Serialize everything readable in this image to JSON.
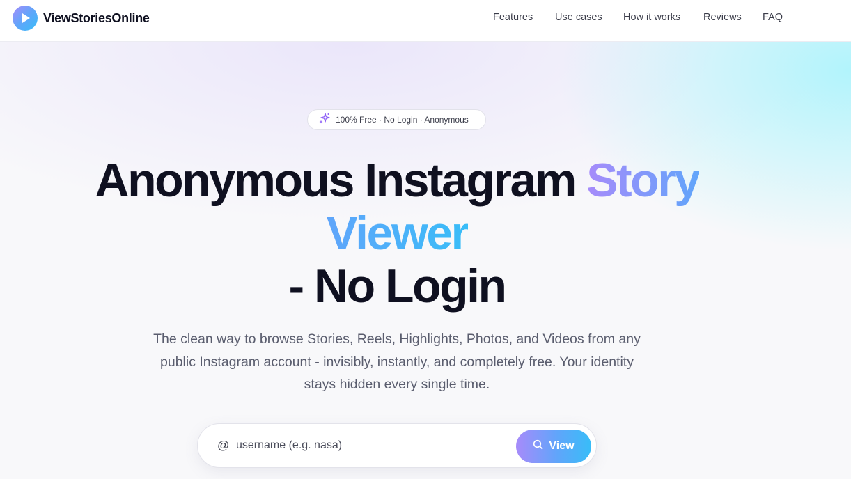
{
  "brand": {
    "name": "ViewStoriesOnline",
    "logo_icon": "play-icon"
  },
  "nav": {
    "items": [
      {
        "label": "Features"
      },
      {
        "label": "Use cases"
      },
      {
        "label": "How it works"
      },
      {
        "label": "Reviews"
      },
      {
        "label": "FAQ"
      }
    ]
  },
  "hero": {
    "badge": {
      "icon": "sparkles-icon",
      "text": "100% Free · No Login · Anonymous"
    },
    "title": {
      "part1": "Anonymous Instagram ",
      "highlight1": "Story",
      "highlight2": "Viewer",
      "part2": "- No Login"
    },
    "subtitle": "The clean way to browse Stories, Reels, Highlights, Photos, and Videos from any public Instagram account - invisibly, instantly, and completely free. Your identity stays hidden every single time."
  },
  "search": {
    "prefix": "@",
    "placeholder": "username (e.g. nasa)",
    "value": "",
    "button_label": "View",
    "button_icon": "search-icon"
  },
  "colors": {
    "accent_start": "#a78bfa",
    "accent_mid": "#60a5fa",
    "accent_end": "#38bdf8",
    "text_dark": "#0f1020",
    "text_muted": "#5a5d6e"
  }
}
